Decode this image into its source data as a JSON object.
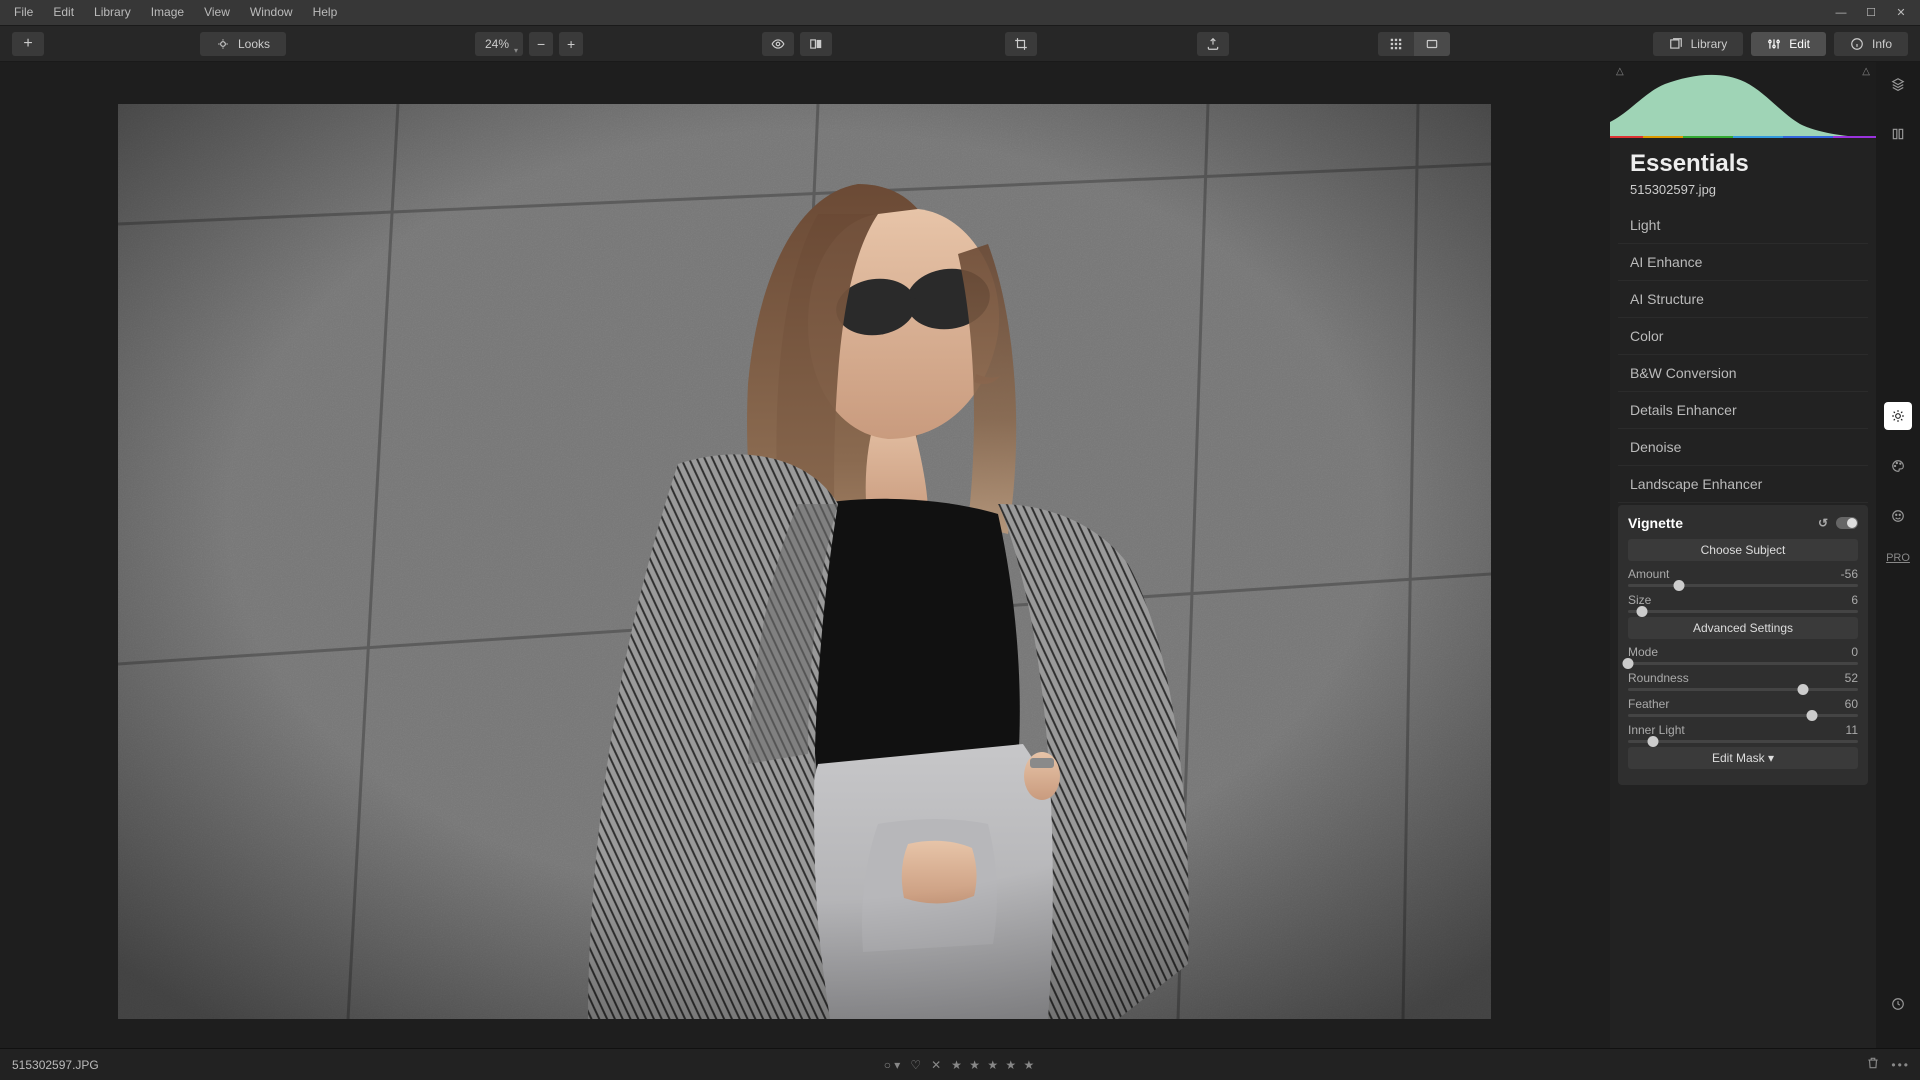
{
  "menu": {
    "items": [
      "File",
      "Edit",
      "Library",
      "Image",
      "View",
      "Window",
      "Help"
    ]
  },
  "toolbar": {
    "looks_label": "Looks",
    "zoom_label": "24%",
    "library_label": "Library",
    "edit_label": "Edit",
    "info_label": "Info"
  },
  "panel": {
    "title": "Essentials",
    "filename": "515302597.jpg",
    "categories": [
      "Light",
      "AI Enhance",
      "AI Structure",
      "Color",
      "B&W Conversion",
      "Details Enhancer",
      "Denoise",
      "Landscape Enhancer"
    ],
    "vignette": {
      "title": "Vignette",
      "choose_subject": "Choose Subject",
      "advanced": "Advanced Settings",
      "edit_mask": "Edit Mask ▾",
      "sliders": {
        "amount": {
          "label": "Amount",
          "value": "-56",
          "min": -100,
          "max": 100,
          "pos": 22
        },
        "size": {
          "label": "Size",
          "value": "6",
          "min": 0,
          "max": 100,
          "pos": 6
        },
        "mode": {
          "label": "Mode",
          "value": "0",
          "min": 0,
          "max": 100,
          "pos": 0
        },
        "roundness": {
          "label": "Roundness",
          "value": "52",
          "min": -100,
          "max": 100,
          "pos": 76
        },
        "feather": {
          "label": "Feather",
          "value": "60",
          "min": 0,
          "max": 100,
          "pos": 80
        },
        "innerlight": {
          "label": "Inner Light",
          "value": "11",
          "min": 0,
          "max": 100,
          "pos": 11
        }
      }
    }
  },
  "vtools": {
    "pro_label": "PRO"
  },
  "status": {
    "filename": "515302597.JPG",
    "stars": "★ ★ ★ ★ ★"
  }
}
